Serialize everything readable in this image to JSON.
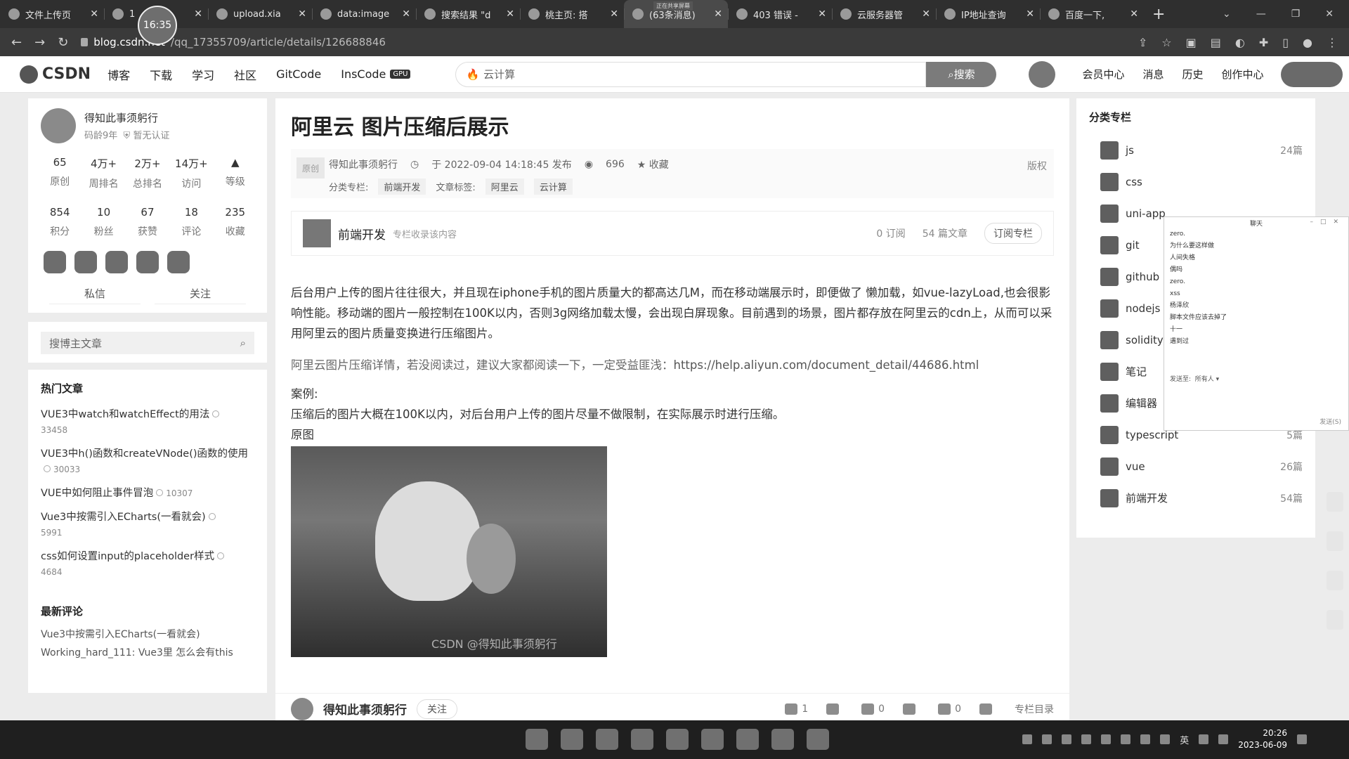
{
  "browser": {
    "clock": "16:35",
    "rec_badge": "正在共享屏幕",
    "tabs": [
      {
        "title": "文件上传页"
      },
      {
        "title": "1"
      },
      {
        "title": "upload.xia"
      },
      {
        "title": "data:image"
      },
      {
        "title": "搜索结果 \"d"
      },
      {
        "title": "桃主页: 搭"
      },
      {
        "title": "(63条消息)"
      },
      {
        "title": "403 错误 -"
      },
      {
        "title": "云服务器管"
      },
      {
        "title": "IP地址查询"
      },
      {
        "title": "百度一下,"
      }
    ],
    "url_host": "blog.csdn.net",
    "url_path": "/qq_17355709/article/details/126688846"
  },
  "nav": {
    "logo": "CSDN",
    "links": [
      "博客",
      "下载",
      "学习",
      "社区",
      "GitCode",
      "InsCode"
    ],
    "gpu": "GPU",
    "search_placeholder": "云计算",
    "search_btn": "搜索",
    "right": [
      "会员中心",
      "消息",
      "历史",
      "创作中心"
    ]
  },
  "profile": {
    "name": "得知此事须躬行",
    "age": "码龄9年",
    "auth": "暂无认证",
    "stats1": [
      {
        "n": "65",
        "l": "原创"
      },
      {
        "n": "4万+",
        "l": "周排名"
      },
      {
        "n": "2万+",
        "l": "总排名"
      },
      {
        "n": "14万+",
        "l": "访问"
      },
      {
        "n": "",
        "l": "等级"
      }
    ],
    "stats2": [
      {
        "n": "854",
        "l": "积分"
      },
      {
        "n": "10",
        "l": "粉丝"
      },
      {
        "n": "67",
        "l": "获赞"
      },
      {
        "n": "18",
        "l": "评论"
      },
      {
        "n": "235",
        "l": "收藏"
      }
    ],
    "btn_msg": "私信",
    "btn_follow": "关注"
  },
  "blog_search": {
    "placeholder": "搜博主文章"
  },
  "hot": {
    "title": "热门文章",
    "items": [
      {
        "t": "VUE3中watch和watchEffect的用法",
        "c": "33458"
      },
      {
        "t": "VUE3中h()函数和createVNode()函数的使用",
        "c": "30033"
      },
      {
        "t": "VUE中如何阻止事件冒泡",
        "c": "10307"
      },
      {
        "t": "Vue3中按需引入ECharts(一看就会)",
        "c": "5991"
      },
      {
        "t": "css如何设置input的placeholder样式",
        "c": "4684"
      }
    ]
  },
  "comments": {
    "title": "最新评论",
    "items": [
      "Vue3中按需引入ECharts(一看就会)",
      "Working_hard_111: Vue3里 怎么会有this"
    ]
  },
  "article": {
    "title": "阿里云 图片压缩后展示",
    "orig": "原创",
    "author": "得知此事须躬行",
    "date": "于 2022-09-04 14:18:45 发布",
    "views": "696",
    "fav": "收藏",
    "copyright": "版权",
    "column_label": "分类专栏:",
    "column_tag": "前端开发",
    "tag_label": "文章标签:",
    "tags": [
      "阿里云",
      "云计算"
    ],
    "col_name": "前端开发",
    "col_desc": "专栏收录该内容",
    "col_subs": "0 订阅",
    "col_count": "54 篇文章",
    "col_btn": "订阅专栏",
    "p1": "后台用户上传的图片往往很大，并且现在iphone手机的图片质量大的都高达几M，而在移动端展示时，即便做了 懒加载，如vue-lazyLoad,也会很影响性能。移动端的图片一般控制在100K以内，否则3g网络加载太慢，会出现白屏现象。目前遇到的场景，图片都存放在阿里云的cdn上，从而可以采用阿里云的图片质量变换进行压缩图片。",
    "p2": "阿里云图片压缩详情，若没阅读过，建议大家都阅读一下，一定受益匪浅：",
    "p2_link": "https://help.aliyun.com/document_detail/44686.html",
    "case_label": "案例:",
    "p3": "压缩后的图片大概在100K以内，对后台用户上传的图片尽量不做限制，在实际展示时进行压缩。",
    "orig_img": "原图",
    "watermark": "CSDN @得知此事须躬行",
    "footer_name": "得知此事须躬行",
    "footer_follow": "关注",
    "likes": "1",
    "stars": "0",
    "comments": "0",
    "col_dir": "专栏目录"
  },
  "category": {
    "title": "分类专栏",
    "items": [
      {
        "name": "js",
        "num": "24篇"
      },
      {
        "name": "css",
        "num": ""
      },
      {
        "name": "uni-app",
        "num": ""
      },
      {
        "name": "git",
        "num": ""
      },
      {
        "name": "github",
        "num": ""
      },
      {
        "name": "nodejs",
        "num": ""
      },
      {
        "name": "solidity",
        "num": ""
      },
      {
        "name": "笔记",
        "num": ""
      },
      {
        "name": "编辑器",
        "num": ""
      },
      {
        "name": "typescript",
        "num": "5篇"
      },
      {
        "name": "vue",
        "num": "26篇"
      },
      {
        "name": "前端开发",
        "num": "54篇"
      }
    ]
  },
  "chat": {
    "title": "聊天",
    "messages": [
      "zero.",
      "为什么要这样做",
      "人间失格",
      "偶吗",
      "zero.",
      "xss",
      "杨泽欣",
      "脚本文件应该去掉了",
      "十一",
      "遇到过"
    ],
    "send_to": "发送至:",
    "all": "所有人",
    "send": "发送(S)"
  },
  "taskbar": {
    "lang": "英",
    "time": "20:26",
    "date": "2023-06-09"
  }
}
